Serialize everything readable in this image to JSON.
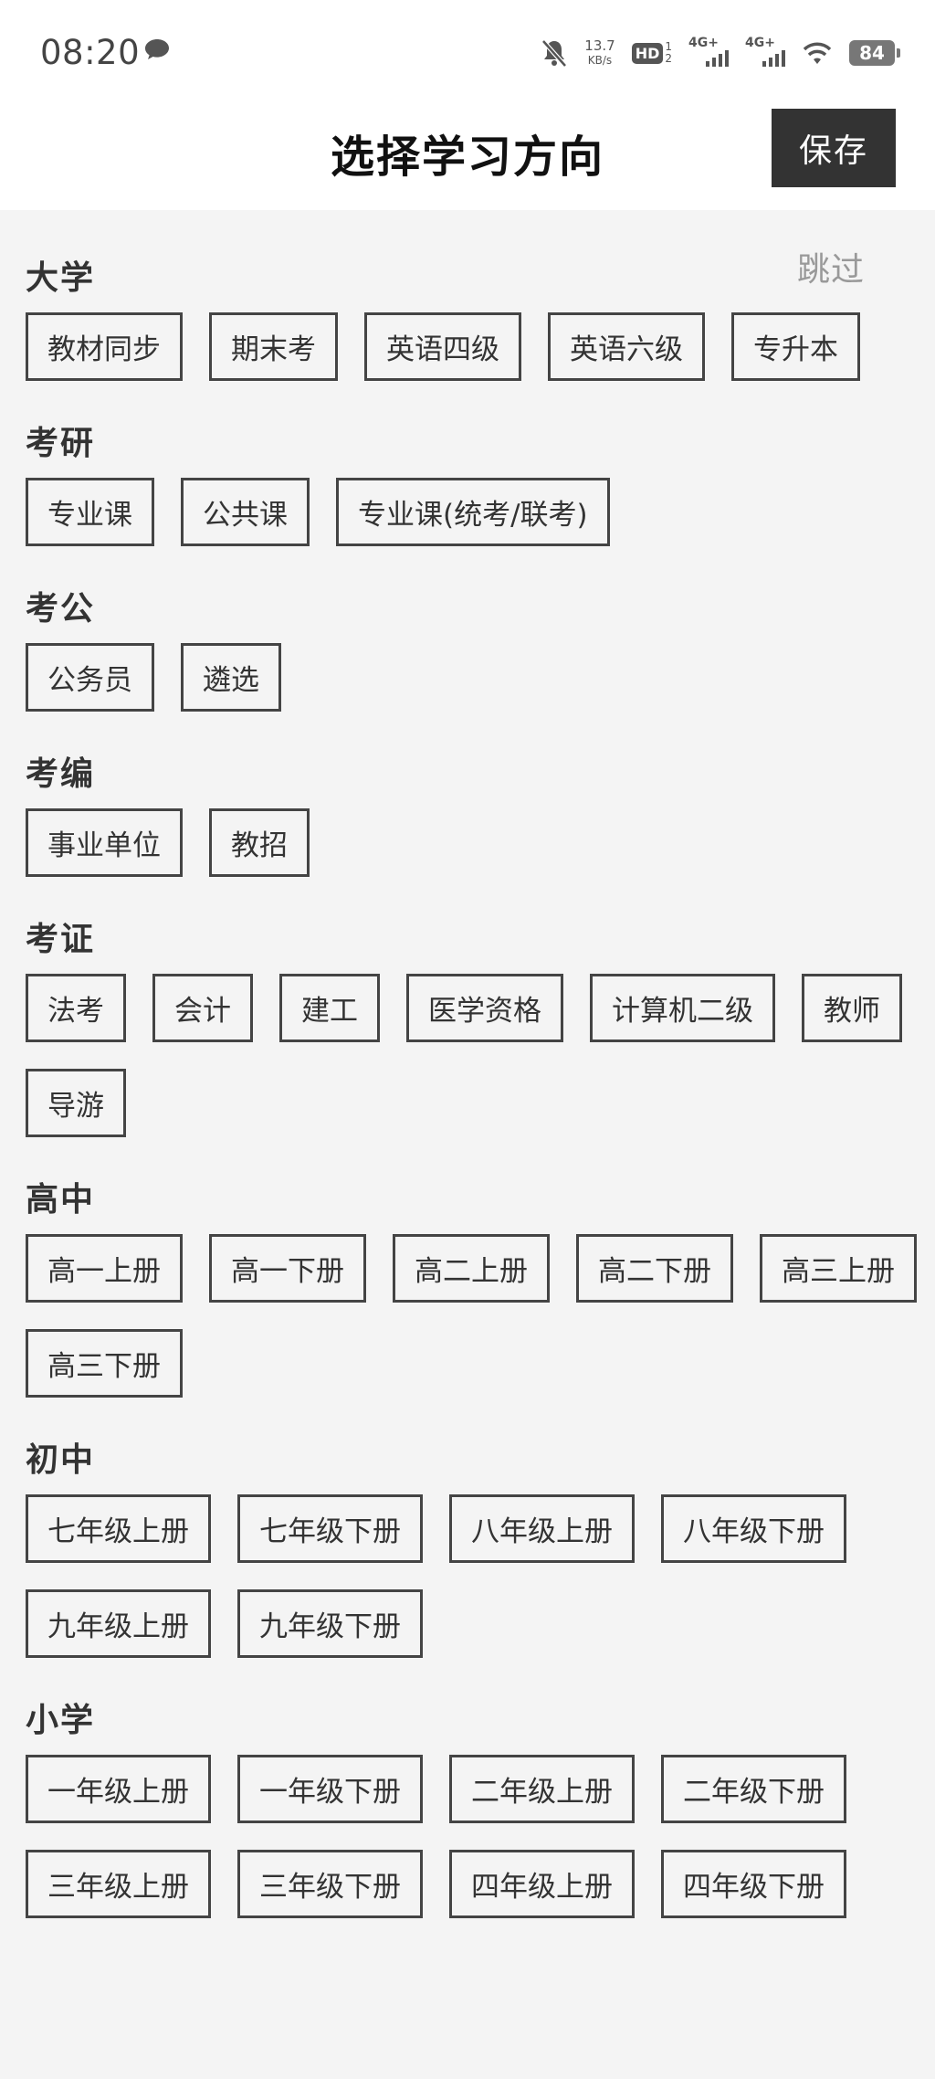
{
  "status_bar": {
    "time": "08:20",
    "speed_value": "13.7",
    "speed_unit": "KB/s",
    "hd_label": "HD",
    "hd_top": "1",
    "hd_bottom": "2",
    "network_1": "4G+",
    "network_2": "4G+",
    "battery": "84"
  },
  "header": {
    "title": "选择学习方向",
    "save_label": "保存"
  },
  "skip_label": "跳过",
  "sections": [
    {
      "title": "大学",
      "items": [
        "教材同步",
        "期末考",
        "英语四级",
        "英语六级",
        "专升本"
      ]
    },
    {
      "title": "考研",
      "items": [
        "专业课",
        "公共课",
        "专业课(统考/联考)"
      ]
    },
    {
      "title": "考公",
      "items": [
        "公务员",
        "遴选"
      ]
    },
    {
      "title": "考编",
      "items": [
        "事业单位",
        "教招"
      ]
    },
    {
      "title": "考证",
      "items": [
        "法考",
        "会计",
        "建工",
        "医学资格",
        "计算机二级",
        "教师",
        "导游"
      ]
    },
    {
      "title": "高中",
      "items": [
        "高一上册",
        "高一下册",
        "高二上册",
        "高二下册",
        "高三上册",
        "高三下册"
      ]
    },
    {
      "title": "初中",
      "items": [
        "七年级上册",
        "七年级下册",
        "八年级上册",
        "八年级下册",
        "九年级上册",
        "九年级下册"
      ]
    },
    {
      "title": "小学",
      "items": [
        "一年级上册",
        "一年级下册",
        "二年级上册",
        "二年级下册",
        "三年级上册",
        "三年级下册",
        "四年级上册",
        "四年级下册"
      ]
    }
  ]
}
